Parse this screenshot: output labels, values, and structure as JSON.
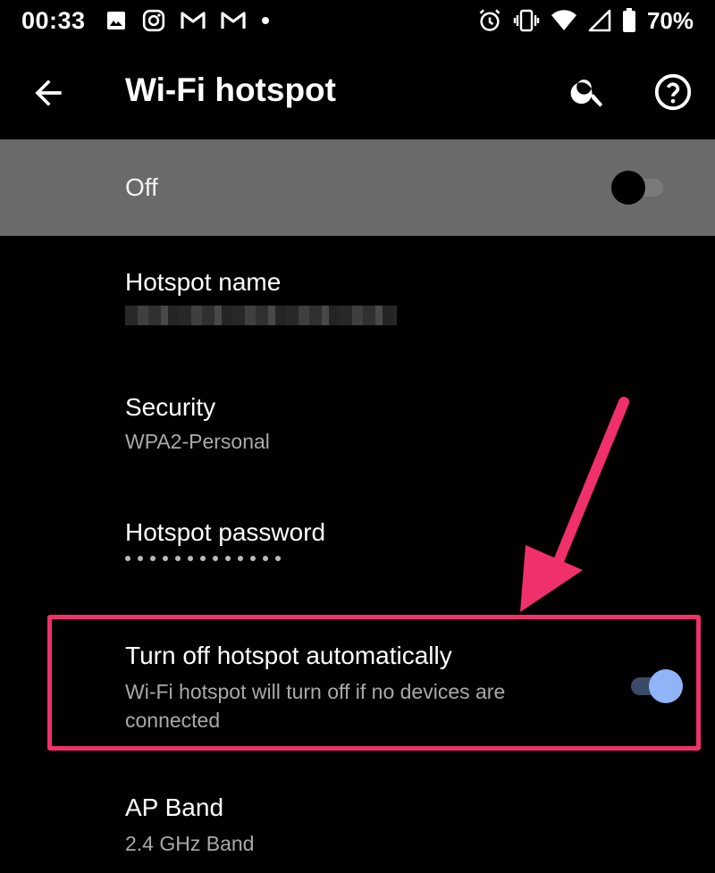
{
  "status_bar": {
    "time": "00:33",
    "battery": "70%",
    "left_icons": [
      "image-icon",
      "instagram-icon",
      "gmail-icon",
      "gmail-icon",
      "dot-icon"
    ],
    "right_icons": [
      "alarm-icon",
      "vibrate-icon",
      "wifi-icon",
      "signal-icon",
      "battery-icon"
    ]
  },
  "app_bar": {
    "title": "Wi-Fi hotspot",
    "back_icon": "arrow-back-icon",
    "search_icon": "search-icon",
    "help_icon": "help-circle-icon"
  },
  "master_switch": {
    "label": "Off",
    "checked": false
  },
  "settings": {
    "hotspot_name": {
      "title": "Hotspot name"
    },
    "security": {
      "title": "Security",
      "value": "WPA2-Personal"
    },
    "password": {
      "title": "Hotspot password",
      "masked_length": 13
    },
    "auto_off": {
      "title": "Turn off hotspot automatically",
      "summary": "Wi-Fi hotspot will turn off if no devices are connected",
      "checked": true
    },
    "ap_band": {
      "title": "AP Band",
      "value": "2.4 GHz Band"
    }
  },
  "colors": {
    "background": "#000000",
    "master_bar": "#6a6a6a",
    "annotation": "#f0306b",
    "toggle_on_thumb": "#8fb4f7",
    "secondary_text": "#a9a9a9"
  }
}
